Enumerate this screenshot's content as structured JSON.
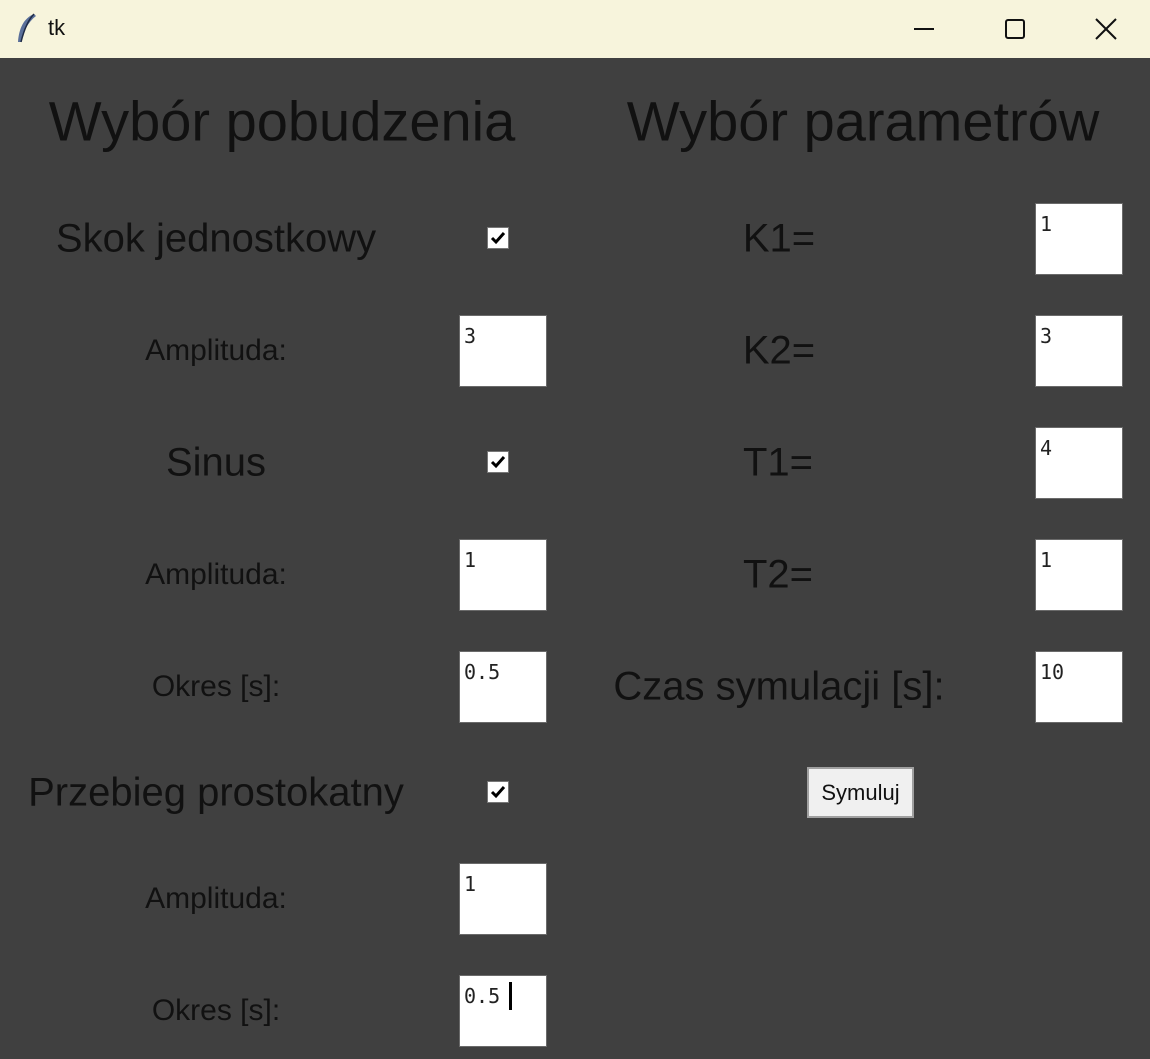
{
  "window": {
    "title": "tk",
    "app_icon": "feather-icon",
    "controls": [
      "minimize-icon",
      "maximize-icon",
      "close-icon"
    ]
  },
  "left": {
    "heading": "Wybór pobudzenia",
    "step": {
      "label": "Skok jednostkowy",
      "checked": true,
      "amplitude_label": "Amplituda:",
      "amplitude_value": "3"
    },
    "sine": {
      "label": "Sinus",
      "checked": true,
      "amplitude_label": "Amplituda:",
      "amplitude_value": "1",
      "period_label": "Okres [s]:",
      "period_value": "0.5"
    },
    "square": {
      "label": "Przebieg prostokatny",
      "checked": true,
      "amplitude_label": "Amplituda:",
      "amplitude_value": "1",
      "period_label": "Okres [s]:",
      "period_value": "0.5"
    }
  },
  "right": {
    "heading": "Wybór parametrów",
    "k1": {
      "label": "K1=",
      "value": "1"
    },
    "k2": {
      "label": "K2=",
      "value": "3"
    },
    "t1": {
      "label": "T1=",
      "value": "4"
    },
    "t2": {
      "label": "T2=",
      "value": "1"
    },
    "sim_time": {
      "label": "Czas symulacji [s]:",
      "value": "10"
    },
    "simulate_label": "Symuluj"
  },
  "colors": {
    "titlebar": "#f7f4dc",
    "background": "#404040",
    "text": "#111111",
    "entry": "#ffffff"
  }
}
